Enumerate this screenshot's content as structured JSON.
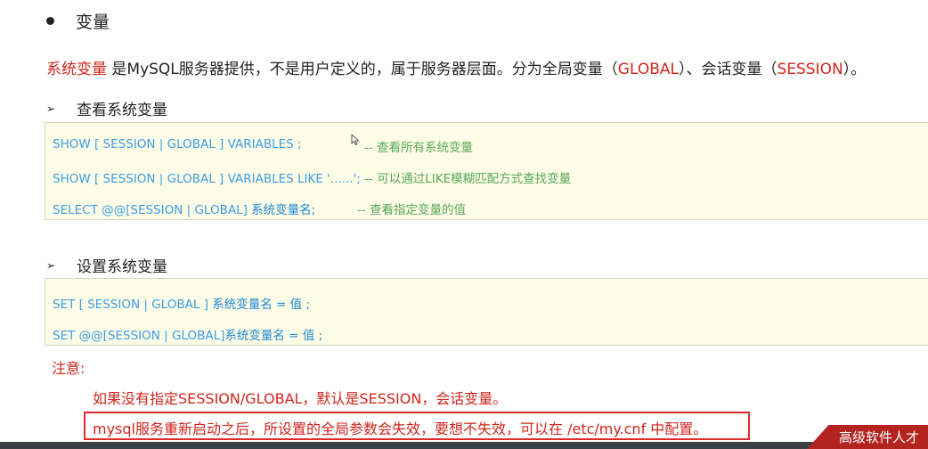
{
  "heading": "变量",
  "intro": {
    "term": "系统变量",
    "text1": " 是MySQL服务器提供，不是用户定义的，属于服务器层面。分为全局变量（",
    "global": "GLOBAL",
    "text2": "）、会话变量（",
    "session": "SESSION",
    "text3": "）。"
  },
  "view_section": {
    "heading": "查看系统变量",
    "lines": [
      {
        "code": "SHOW  [ SESSION | GLOBAL ]   VARIABLES ;",
        "comment": "-- 查看所有系统变量"
      },
      {
        "code": "SHOW  [ SESSION | GLOBAL ]   VARIABLES  LIKE  '......';",
        "comment": "-- 可以通过LIKE模糊匹配方式查找变量"
      },
      {
        "code": "SELECT  @@[SESSION | GLOBAL]",
        "code_strong": "系统变量名;",
        "comment": "--  查看指定变量的值"
      }
    ]
  },
  "set_section": {
    "heading": "设置系统变量",
    "lines": [
      {
        "code": "SET  [ SESSION | GLOBAL ]",
        "code_strong": "系统变量名 = 值 ;"
      },
      {
        "code": "SET  @@[SESSION | GLOBAL]",
        "code_strong": "系统变量名 = 值 ;"
      }
    ]
  },
  "note": {
    "title": "注意:",
    "line1": "如果没有指定SESSION/GLOBAL，默认是SESSION，会话变量。",
    "line2": "mysql服务重新启动之后，所设置的全局参数会失效，要想不失效，可以在 /etc/my.cnf 中配置。"
  },
  "watermark": "高级软件人才",
  "colors": {
    "accent_red": "#d0261b",
    "code_blue": "#3d9de4",
    "comment_green": "#58a85a",
    "code_bg": "#fdfce6"
  }
}
